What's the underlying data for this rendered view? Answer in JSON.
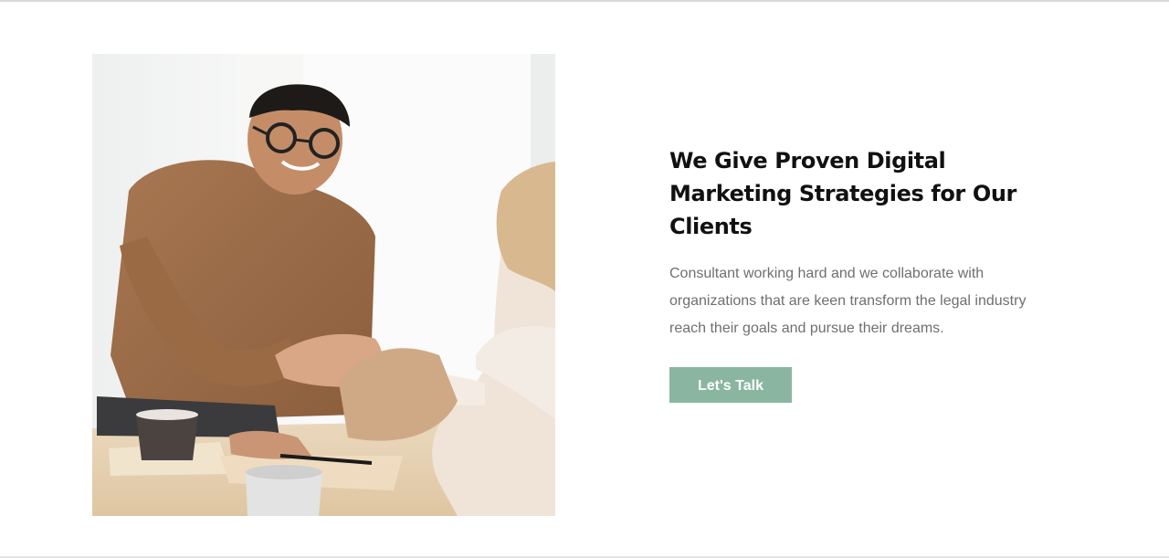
{
  "hero": {
    "headline": "We Give Proven Digital Marketing Strategies for Our Clients",
    "body": "Consultant working hard and we collaborate with organizations that are keen transform the legal industry reach their goals and pursue their dreams.",
    "cta_label": "Let's Talk"
  },
  "image": {
    "subject": "handshake-photo"
  },
  "colors": {
    "accent": "#8ab6a1",
    "heading": "#111111",
    "body": "#6f6f6f",
    "background": "#ffffff"
  }
}
